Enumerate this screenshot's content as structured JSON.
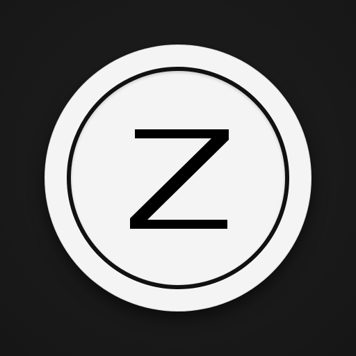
{
  "icon": {
    "name": "z-circle-logo-icon",
    "letter": "Z",
    "colors": {
      "background": "#1a1a1a",
      "badge": "#f4f4f4",
      "ring": "#111111",
      "letter": "#000000"
    }
  }
}
